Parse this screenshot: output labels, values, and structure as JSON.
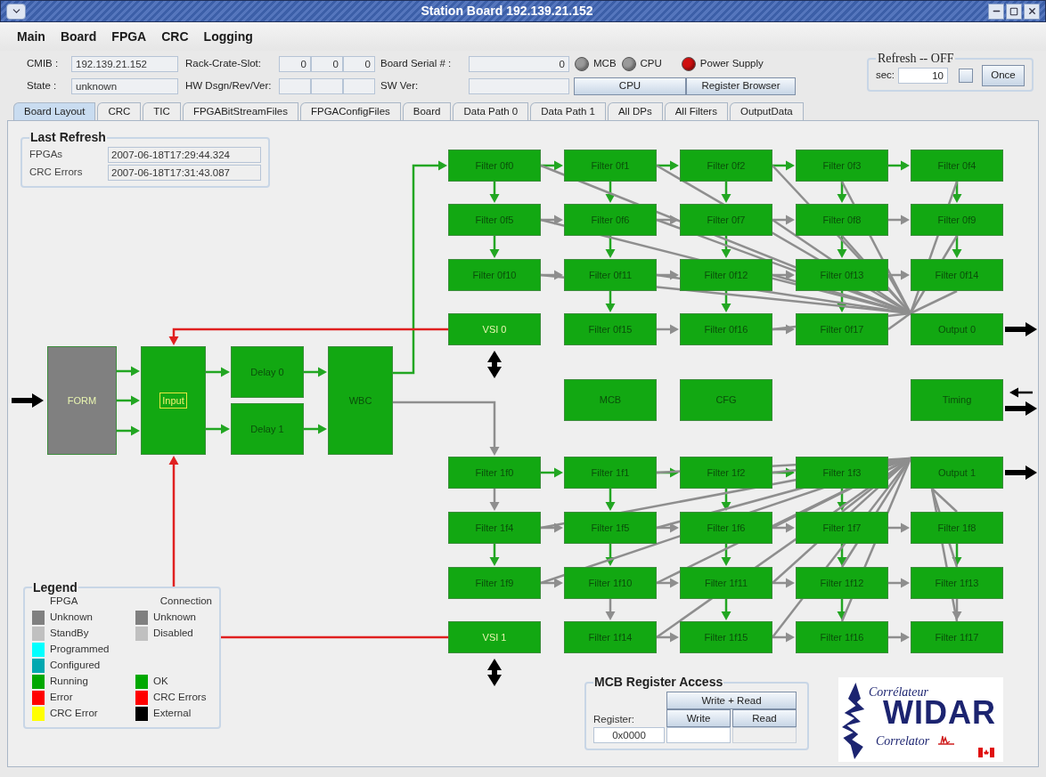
{
  "window": {
    "title": "Station Board 192.139.21.152"
  },
  "menu": [
    "Main",
    "Board",
    "FPGA",
    "CRC",
    "Logging"
  ],
  "header": {
    "cmib": {
      "label": "CMIB :",
      "value": "192.139.21.152"
    },
    "state": {
      "label": "State :",
      "value": "unknown"
    },
    "rack_crate_slot": {
      "label": "Rack-Crate-Slot:",
      "values": [
        "0",
        "0",
        "0"
      ]
    },
    "hw_dsgn_rev_ver": {
      "label": "HW Dsgn/Rev/Ver:"
    },
    "board_serial": {
      "label": "Board Serial # :",
      "value": "0"
    },
    "sw_ver": {
      "label": "SW Ver:"
    },
    "indicators": [
      {
        "label": "MCB",
        "color": "#9a9a9a"
      },
      {
        "label": "CPU",
        "color": "#9a9a9a"
      },
      {
        "label": "Power Supply",
        "color": "#d01010"
      }
    ],
    "buttons": [
      "CPU",
      "Register Browser"
    ]
  },
  "refresh": {
    "title": "Refresh -- OFF",
    "sec_label": "sec:",
    "sec_value": "10",
    "checked": false,
    "button": "Once"
  },
  "tabs": [
    {
      "label": "Board Layout",
      "selected": true
    },
    {
      "label": "CRC",
      "selected": false
    },
    {
      "label": "TIC",
      "selected": false
    },
    {
      "label": "FPGABitStreamFiles",
      "selected": false
    },
    {
      "label": "FPGAConfigFiles",
      "selected": false
    },
    {
      "label": "Board",
      "selected": false
    },
    {
      "label": "Data Path 0",
      "selected": false
    },
    {
      "label": "Data Path 1",
      "selected": false
    },
    {
      "label": "All DPs",
      "selected": false
    },
    {
      "label": "All Filters",
      "selected": false
    },
    {
      "label": "OutputData",
      "selected": false
    }
  ],
  "last_refresh": {
    "title": "Last Refresh",
    "rows": [
      {
        "label": "FPGAs",
        "value": "2007-06-18T17:29:44.324"
      },
      {
        "label": "CRC Errors",
        "value": "2007-06-18T17:31:43.087"
      }
    ]
  },
  "diagram": {
    "form": {
      "label": "FORM",
      "color": "#808080"
    },
    "input": {
      "label": "Input",
      "color": "#12a812"
    },
    "delays": [
      {
        "label": "Delay 0",
        "color": "#12a812"
      },
      {
        "label": "Delay 1",
        "color": "#12a812"
      }
    ],
    "wbc": {
      "label": "WBC",
      "color": "#12a812"
    },
    "datapaths": [
      {
        "filters": [
          {
            "label": "Filter 0f0",
            "color": "#12a812"
          },
          {
            "label": "Filter 0f1",
            "color": "#12a812"
          },
          {
            "label": "Filter 0f2",
            "color": "#12a812"
          },
          {
            "label": "Filter 0f3",
            "color": "#12a812"
          },
          {
            "label": "Filter 0f4",
            "color": "#12a812"
          },
          {
            "label": "Filter 0f5",
            "color": "#12a812"
          },
          {
            "label": "Filter 0f6",
            "color": "#12a812"
          },
          {
            "label": "Filter 0f7",
            "color": "#12a812"
          },
          {
            "label": "Filter 0f8",
            "color": "#12a812"
          },
          {
            "label": "Filter 0f9",
            "color": "#12a812"
          },
          {
            "label": "Filter 0f10",
            "color": "#12a812"
          },
          {
            "label": "Filter 0f11",
            "color": "#12a812"
          },
          {
            "label": "Filter 0f12",
            "color": "#12a812"
          },
          {
            "label": "Filter 0f13",
            "color": "#12a812"
          },
          {
            "label": "Filter 0f14",
            "color": "#12a812"
          },
          {
            "label": "Filter 0f15",
            "color": "#12a812"
          },
          {
            "label": "Filter 0f16",
            "color": "#12a812"
          },
          {
            "label": "Filter 0f17",
            "color": "#12a812"
          }
        ],
        "vsi": {
          "label": "VSI 0",
          "color": "#12a812"
        },
        "output": {
          "label": "Output 0",
          "color": "#12a812"
        }
      },
      {
        "filters": [
          {
            "label": "Filter 1f0",
            "color": "#12a812"
          },
          {
            "label": "Filter 1f1",
            "color": "#12a812"
          },
          {
            "label": "Filter 1f2",
            "color": "#12a812"
          },
          {
            "label": "Filter 1f3",
            "color": "#12a812"
          },
          {
            "label": "Filter 1f4",
            "color": "#12a812"
          },
          {
            "label": "Filter 1f5",
            "color": "#12a812"
          },
          {
            "label": "Filter 1f6",
            "color": "#12a812"
          },
          {
            "label": "Filter 1f7",
            "color": "#12a812"
          },
          {
            "label": "Filter 1f8",
            "color": "#12a812"
          },
          {
            "label": "Filter 1f9",
            "color": "#12a812"
          },
          {
            "label": "Filter 1f10",
            "color": "#12a812"
          },
          {
            "label": "Filter 1f11",
            "color": "#12a812"
          },
          {
            "label": "Filter 1f12",
            "color": "#12a812"
          },
          {
            "label": "Filter 1f13",
            "color": "#12a812"
          },
          {
            "label": "Filter 1f14",
            "color": "#12a812"
          },
          {
            "label": "Filter 1f15",
            "color": "#12a812"
          },
          {
            "label": "Filter 1f16",
            "color": "#12a812"
          },
          {
            "label": "Filter 1f17",
            "color": "#12a812"
          }
        ],
        "vsi": {
          "label": "VSI 1",
          "color": "#12a812"
        },
        "output": {
          "label": "Output 1",
          "color": "#12a812"
        }
      }
    ],
    "mcb": {
      "label": "MCB",
      "color": "#12a812"
    },
    "cfg": {
      "label": "CFG",
      "color": "#12a812"
    },
    "timing": {
      "label": "Timing",
      "color": "#12a812"
    },
    "connections": [
      {
        "kind": "external",
        "color": "#000000"
      },
      {
        "kind": "input_path",
        "color": "#22a622"
      },
      {
        "kind": "wbc_to_dp1",
        "color": "#8e8e8e"
      },
      {
        "kind": "vsi_return",
        "color": "#e02020"
      },
      {
        "kind": "dp0_forward",
        "color": "#22a622"
      },
      {
        "kind": "dp0_side",
        "color": "#8e8e8e"
      },
      {
        "kind": "dp1_forward",
        "color": "#22a622"
      },
      {
        "kind": "dp1_side",
        "color": "#8e8e8e"
      }
    ]
  },
  "legend": {
    "title": "Legend",
    "fpga_heading": "FPGA",
    "connection_heading": "Connection",
    "fpga": [
      {
        "label": "Unknown",
        "color": "#808080"
      },
      {
        "label": "StandBy",
        "color": "#c0c0c0"
      },
      {
        "label": "Programmed",
        "color": "#00ffff"
      },
      {
        "label": "Configured",
        "color": "#00a8b0"
      },
      {
        "label": "Running",
        "color": "#00a800"
      },
      {
        "label": "Error",
        "color": "#ff0000"
      },
      {
        "label": "CRC Error",
        "color": "#ffff00"
      }
    ],
    "connection": [
      {
        "label": "Unknown",
        "color": "#808080"
      },
      {
        "label": "Disabled",
        "color": "#c0c0c0"
      },
      {
        "label": "OK",
        "color": "#00a800"
      },
      {
        "label": "CRC Errors",
        "color": "#ff0000"
      },
      {
        "label": "External",
        "color": "#000000"
      }
    ]
  },
  "mcb_register": {
    "title": "MCB Register Access",
    "write_read": "Write + Read",
    "write": "Write",
    "read": "Read",
    "register_label": "Register:",
    "register_value": "0x0000"
  },
  "logo": {
    "top": "Corrélateur",
    "main": "WIDAR",
    "bottom": "Correlator"
  }
}
